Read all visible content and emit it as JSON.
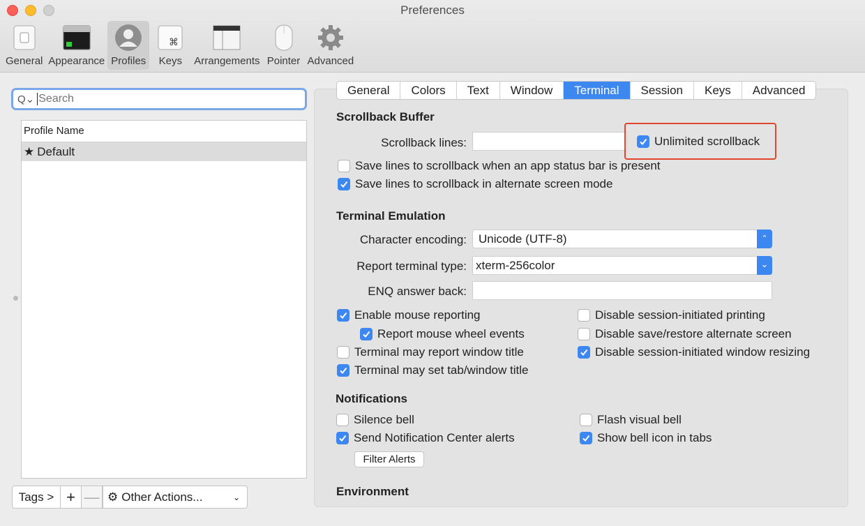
{
  "window": {
    "title": "Preferences"
  },
  "toolbar": {
    "items": [
      {
        "label": "General",
        "icon": "switch-icon"
      },
      {
        "label": "Appearance",
        "icon": "terminal-window-icon"
      },
      {
        "label": "Profiles",
        "icon": "user-silhouette-icon",
        "active": true
      },
      {
        "label": "Keys",
        "icon": "command-key-icon"
      },
      {
        "label": "Arrangements",
        "icon": "window-stack-icon"
      },
      {
        "label": "Pointer",
        "icon": "mouse-icon"
      },
      {
        "label": "Advanced",
        "icon": "gear-icon"
      }
    ]
  },
  "sidebar": {
    "search": {
      "placeholder": "Search",
      "value": ""
    },
    "list_header": "Profile Name",
    "profiles": [
      {
        "name": "Default",
        "default": true
      }
    ],
    "tags_label": "Tags >",
    "add_label": "+",
    "remove_label": "—",
    "actions_label": "Other Actions..."
  },
  "tabs": [
    "General",
    "Colors",
    "Text",
    "Window",
    "Terminal",
    "Session",
    "Keys",
    "Advanced"
  ],
  "active_tab": "Terminal",
  "scrollback": {
    "title": "Scrollback Buffer",
    "lines_label": "Scrollback lines:",
    "lines_value": "",
    "unlimited_label": "Unlimited scrollback",
    "unlimited_checked": true,
    "save_status_bar_label": "Save lines to scrollback when an app status bar is present",
    "save_status_bar_checked": false,
    "save_alternate_label": "Save lines to scrollback in alternate screen mode",
    "save_alternate_checked": true
  },
  "emulation": {
    "title": "Terminal Emulation",
    "encoding_label": "Character encoding:",
    "encoding_value": "Unicode (UTF-8)",
    "report_type_label": "Report terminal type:",
    "report_type_value": "xterm-256color",
    "enq_label": "ENQ answer back:",
    "enq_value": "",
    "mouse_reporting": "Enable mouse reporting",
    "mouse_wheel": "Report mouse wheel events",
    "report_title": "Terminal may report window title",
    "set_title": "Terminal may set tab/window title",
    "disable_printing": "Disable session-initiated printing",
    "disable_alt_screen": "Disable save/restore alternate screen",
    "disable_resizing": "Disable session-initiated window resizing"
  },
  "notifications": {
    "title": "Notifications",
    "silence_bell": "Silence bell",
    "send_alerts": "Send Notification Center alerts",
    "flash_bell": "Flash visual bell",
    "show_bell_icon": "Show bell icon in tabs",
    "filter_alerts": "Filter Alerts"
  },
  "environment": {
    "title": "Environment"
  },
  "colors": {
    "accent": "#3c87f0",
    "highlight": "#e0452f"
  }
}
